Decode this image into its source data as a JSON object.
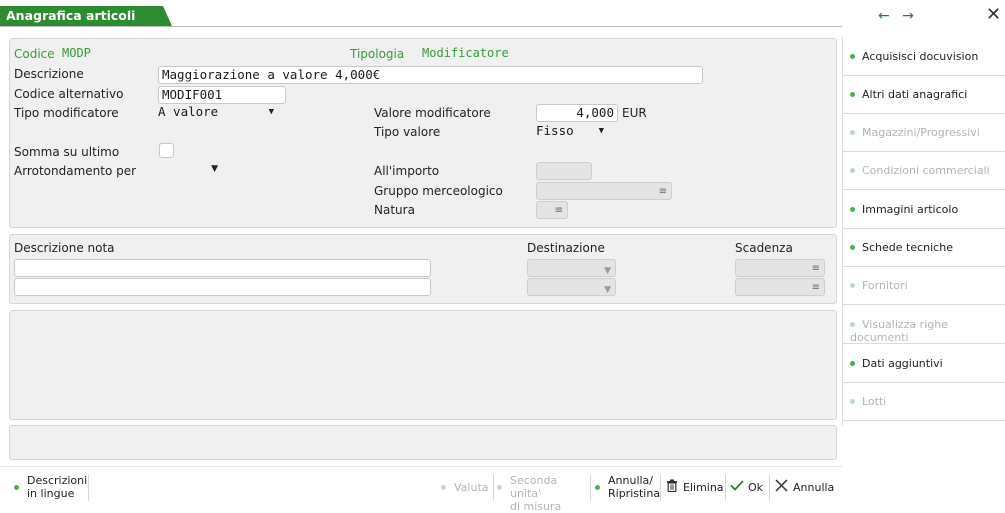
{
  "window": {
    "title": "Anagrafica articoli",
    "nav_arrows": "← →",
    "close_glyph": "✕"
  },
  "header": {
    "codice_label": "Codice",
    "codice_value": "MODP",
    "tipologia_label": "Tipologia",
    "tipologia_value": "Modificatore"
  },
  "form": {
    "descrizione_label": "Descrizione",
    "descrizione_value": "Maggiorazione a valore 4,000€",
    "codice_alt_label": "Codice alternativo",
    "codice_alt_value": "MODIF001",
    "tipo_mod_label": "Tipo modificatore",
    "tipo_mod_value": "A valore",
    "valore_mod_label": "Valore modificatore",
    "valore_mod_value": "4,000",
    "valore_mod_unit": "EUR",
    "tipo_valore_label": "Tipo valore",
    "tipo_valore_value": "Fisso",
    "somma_label": "Somma su ultimo",
    "arrotondamento_label": "Arrotondamento per",
    "all_importo_label": "All'importo",
    "gruppo_label": "Gruppo merceologico",
    "natura_label": "Natura"
  },
  "note": {
    "descrizione_nota_label": "Descrizione nota",
    "destinazione_label": "Destinazione",
    "scadenza_label": "Scadenza"
  },
  "sidebar": {
    "items": [
      {
        "label": "Acquisisci docuvision",
        "enabled": true
      },
      {
        "label": "Altri dati anagrafici",
        "enabled": true
      },
      {
        "label": "Magazzini/Progressivi",
        "enabled": false
      },
      {
        "label": "Condizioni commerciali",
        "enabled": false
      },
      {
        "label": "Immagini articolo",
        "enabled": true
      },
      {
        "label": "Schede tecniche",
        "enabled": true
      },
      {
        "label": "Fornitori",
        "enabled": false
      },
      {
        "label": "Visualizza righe documenti",
        "enabled": false
      },
      {
        "label": "Dati aggiuntivi",
        "enabled": true
      },
      {
        "label": "Lotti",
        "enabled": false
      }
    ]
  },
  "bottom_bar": {
    "descrizioni_line1": "Descrizioni",
    "descrizioni_line2": "in lingue",
    "valuta": "Valuta",
    "seconda_line1": "Seconda unita'",
    "seconda_line2": "di misura",
    "annulla_rip_line1": "Annulla/",
    "annulla_rip_line2": "Ripristina",
    "elimina": "Elimina",
    "ok": "Ok",
    "annulla": "Annulla"
  },
  "icons": {
    "dropdown": "dropdown-caret-icon",
    "list": "list-lookup-icon",
    "trash": "trash-icon",
    "check": "check-icon",
    "cross": "cross-icon"
  },
  "colors": {
    "accent": "#2e8b32",
    "label_green": "#3a9b3e",
    "panel_bg": "#f0f0f0"
  }
}
